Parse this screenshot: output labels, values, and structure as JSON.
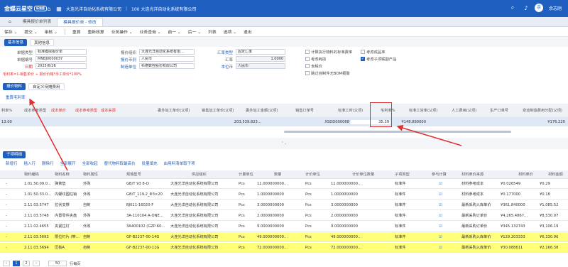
{
  "topbar": {
    "logo": "金蝶云星空",
    "badge": "标准版",
    "org": "大连光洋自动化系统有限公司",
    "year": "100 大连光洋自动化系统有限公司",
    "user": "余志刚"
  },
  "tabs": [
    {
      "label": "模具报价单列表"
    },
    {
      "label": "模具报价单 - 修改"
    }
  ],
  "toolbar": [
    "保存 ⌄",
    "提交 ⌄",
    "审核 ⌄",
    "重算",
    "重新核算",
    "业务操作 ⌄",
    "业务查询 ⌄",
    "前一 ⌄",
    "后一 ⌄",
    "列表",
    "选项 ⌄",
    "退出"
  ],
  "section_tabs": [
    "基本信息",
    "其他信息"
  ],
  "form": {
    "doc_type_label": "单据类型",
    "doc_type": "标准模拟报价单",
    "doc_no_label": "单据编号",
    "doc_no": "MNBJ0000037",
    "date_label": "日期",
    "date": "2025/6/26",
    "rate_note": "毛利率=1-销售单价 ÷ 报价价格*手工单价*100%",
    "org_label": "报价组织",
    "org": "大连光洋自动化系统有限…",
    "currency_label": "报价币别",
    "currency": "人民币",
    "sales_org_label": "制造单位",
    "sales_org": "科德数控股份有限公司",
    "rate_type_label": "汇率类型",
    "rate_type": "固定汇率",
    "rate_label": "汇率",
    "rate": "1.0000",
    "base_cur_label": "本位币",
    "base_cur": "人民币",
    "checks": [
      {
        "label": "计算执行物料的标准费率",
        "on": false
      },
      {
        "label": "考虑耗损",
        "on": false
      },
      {
        "label": "含税价",
        "on": false
      },
      {
        "label": "跳过自制件无BOM报警",
        "on": false
      }
    ],
    "checks2": [
      {
        "label": "考虑成品率",
        "on": false
      },
      {
        "label": "考虑子项联副产品",
        "on": true
      }
    ]
  },
  "mid_tabs": [
    "报价物料",
    "自定义待摊费用"
  ],
  "mid_link": "重算毛利率",
  "main_headers": [
    "利率%",
    "成本参考类型",
    "成本单价",
    "成本参考类型",
    "成本来源",
    "委外加工单价(父项)",
    "销售加工单价(父项)",
    "委外加工金额(父项)",
    "销售订单号",
    "标准工时(父项)",
    "毛利率%",
    "标准工资率(父项)",
    "人工费用(父项)",
    "生产订单号",
    "变动制造费用分配(父项)"
  ],
  "main_row": {
    "qty": "13.00",
    "cost_price": "203,539.823…",
    "order": "XSDD000068",
    "margin": "35.39",
    "wage": "¥148.890000",
    "var": "¥176.220"
  },
  "sub": {
    "title": "子项明细",
    "toolbar": [
      "新增行",
      "插入行",
      "删除行",
      "全部展开",
      "全部收起",
      "替代物料取最高价",
      "批量填充",
      "由用料清单取子项"
    ],
    "headers": [
      "物料编码",
      "物料名称",
      "物料属性",
      "规格型号",
      "供应组织",
      "计量单位",
      "数量",
      "计价单位",
      "计价单位数量",
      "子项类型",
      "参与计算",
      "材料单价来源",
      "材料单价",
      "材料金额"
    ],
    "rows": [
      {
        "code": "1.01.50.09.0…",
        "name": "弹簧垫",
        "attr": "外购",
        "spec": "GB/T 93 8-O",
        "org": "大连光洋自动化系统有限公司",
        "unit": "Pcs",
        "qty": "11.000000000…",
        "punit": "Pcs",
        "pqty": "11.000000000…",
        "type": "标准件",
        "src": "材料参考成本",
        "price": "¥0.026549",
        "amt": "¥0.29",
        "hl": false
      },
      {
        "code": "1.01.50.33.0…",
        "name": "内螺纹圆柱销",
        "attr": "外购",
        "spec": "GB/T_119.2_Φ3×20",
        "org": "大连光洋自动化系统有限公司",
        "unit": "Pcs",
        "qty": "1.0000000000",
        "punit": "Pcs",
        "pqty": "1.0000000000",
        "type": "标准件",
        "src": "材料参考成本",
        "price": "¥0.177000",
        "amt": "¥0.18",
        "hl": false
      },
      {
        "code": "2.11.03.5747",
        "name": "拉伏支撑",
        "attr": "自制",
        "spec": "BJ011-16020-F",
        "org": "大连光洋自动化系统有限公司",
        "unit": "Pcs",
        "qty": "3.0000000000",
        "punit": "Pcs",
        "pqty": "3.0000000000",
        "type": "标准件",
        "src": "最新采购入库单价",
        "price": "¥361.840000",
        "amt": "¥1,085.52",
        "hl": false
      },
      {
        "code": "2.11.03.5748",
        "name": "内置零件夹盘",
        "attr": "外购",
        "spec": "3A-110104 A-ONE…",
        "org": "大连光洋自动化系统有限公司",
        "unit": "Pcs",
        "qty": "2.0000000000",
        "punit": "Pcs",
        "pqty": "2.0000000000",
        "type": "标准件",
        "src": "最新采购订单价",
        "price": "¥4,265.4867…",
        "amt": "¥8,530.97",
        "hl": false
      },
      {
        "code": "2.11.02.4655",
        "name": "夹紧拉钉",
        "attr": "外购",
        "spec": "3A400102 (GZP-60…",
        "org": "大连光洋自动化系统有限公司",
        "unit": "Pcs",
        "qty": "9.0000000000",
        "punit": "Pcs",
        "pqty": "9.0000000000",
        "type": "标准件",
        "src": "最新采购订单价",
        "price": "¥345.132743",
        "amt": "¥3,106.19",
        "hl": false
      },
      {
        "code": "2.11.03.5693",
        "name": "限位钉片 (带…",
        "attr": "自制",
        "spec": "GF-B2237-00-14G",
        "org": "大连光洋自动化系统有限公司",
        "unit": "Pcs",
        "qty": "49.000000000…",
        "punit": "Pcs",
        "pqty": "49.000000000…",
        "type": "标准件",
        "src": "最新采购入库单价",
        "price": "¥129.203333",
        "amt": "¥6,330.96",
        "hl": true
      },
      {
        "code": "2.11.03.5694",
        "name": "压板A",
        "attr": "自制",
        "spec": "GF-B2237-00-11G",
        "org": "大连光洋自动化系统有限公司",
        "unit": "Pcs",
        "qty": "72.000000000…",
        "punit": "Pcs",
        "pqty": "72.000000000…",
        "type": "标准件",
        "src": "最新采购入库单价",
        "price": "¥30.088611",
        "amt": "¥2,166.38",
        "hl": true
      }
    ]
  },
  "pager": {
    "page1": "1",
    "page2": "2",
    "size": "50",
    "unit": "行每页"
  },
  "colors": {
    "brand": "#1f5fbf",
    "highlight": "#ffff7a",
    "annotation": "#e03030"
  }
}
